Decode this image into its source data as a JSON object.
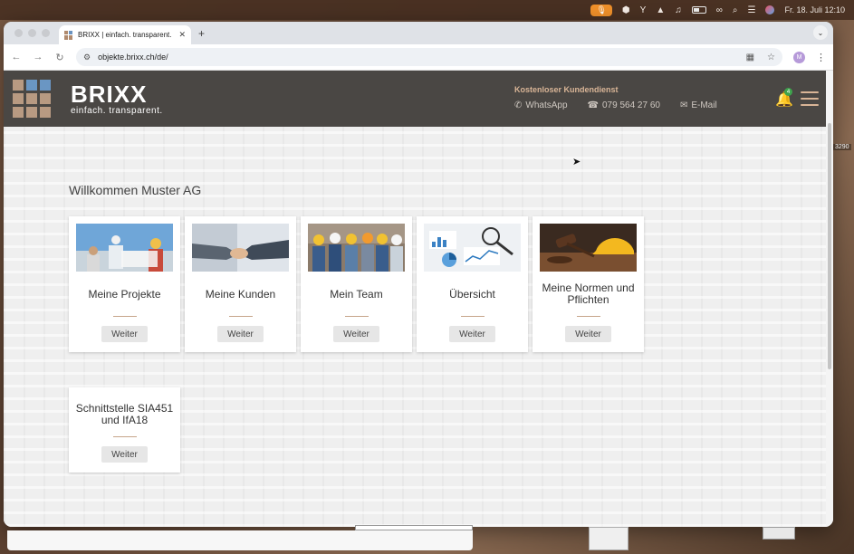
{
  "menubar": {
    "clock": "Fr. 18. Juli  12:10",
    "icons": [
      "apple-icon",
      "microphone-icon",
      "app-icon",
      "tool-icon",
      "drive-icon",
      "headphones-icon",
      "battery-icon",
      "link-icon",
      "search-icon",
      "control-center-icon",
      "siri-icon"
    ]
  },
  "browser": {
    "tab_title": "BRIXX | einfach. transparent.",
    "tab_close": "✕",
    "new_tab": "+",
    "url": "objekte.brixx.ch/de/",
    "profile_initial": "M"
  },
  "header": {
    "brand_name": "BRIXX",
    "brand_tagline": "einfach. transparent.",
    "contact_title": "Kostenloser Kundendienst",
    "whatsapp": "WhatsApp",
    "phone": "079 564 27 60",
    "email": "E-Mail",
    "notification_count": "4",
    "colors": {
      "header_bg": "#4a4744",
      "accent": "#d9b597",
      "logo_blue": "#6a96c3",
      "logo_tan": "#b89a82"
    }
  },
  "main": {
    "welcome": "Willkommen Muster AG",
    "cards": [
      {
        "title": "Meine Projekte",
        "button": "Weiter",
        "image": "construction-workers-plans"
      },
      {
        "title": "Meine Kunden",
        "button": "Weiter",
        "image": "handshake"
      },
      {
        "title": "Mein Team",
        "button": "Weiter",
        "image": "team-with-hardhats"
      },
      {
        "title": "Übersicht",
        "button": "Weiter",
        "image": "charts-with-magnifier"
      },
      {
        "title": "Meine Normen und Pflichten",
        "button": "Weiter",
        "image": "gavel-and-hardhat"
      },
      {
        "title": "Schnittstelle SIA451 und IfA18",
        "button": "Weiter",
        "image": ""
      }
    ]
  },
  "desktop": {
    "side_number": "3290"
  }
}
